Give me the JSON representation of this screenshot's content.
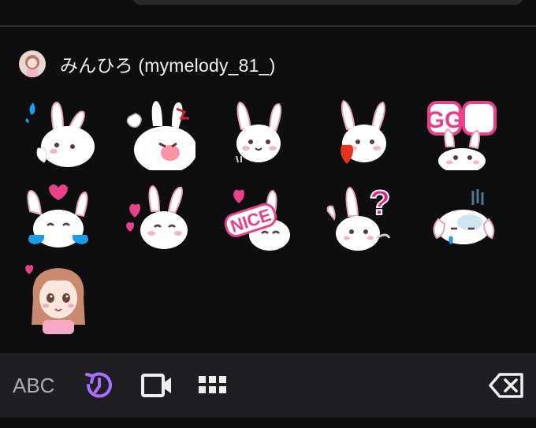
{
  "channel": {
    "name": "みんひろ (mymelody_81_)"
  },
  "emotes": [
    {
      "name": "bunny-sweat"
    },
    {
      "name": "bunny-angry"
    },
    {
      "name": "bunny-blush"
    },
    {
      "name": "bunny-heart"
    },
    {
      "name": "bunny-gg"
    },
    {
      "name": "bunny-cry"
    },
    {
      "name": "bunny-love"
    },
    {
      "name": "bunny-nice"
    },
    {
      "name": "bunny-question"
    },
    {
      "name": "bunny-gloom"
    },
    {
      "name": "girl-heart"
    }
  ],
  "emote_text": {
    "gg": "GG",
    "nice": "NICE",
    "question": "?"
  },
  "keyboard": {
    "abc_label": "ABC",
    "icons": [
      "recent-icon",
      "gif-video-icon",
      "apps-grid-icon",
      "backspace-icon"
    ]
  },
  "colors": {
    "background": "#0e0e10",
    "toolbar": "#1f1f23",
    "accent": "#a970ff",
    "pink": "#e8418a"
  }
}
